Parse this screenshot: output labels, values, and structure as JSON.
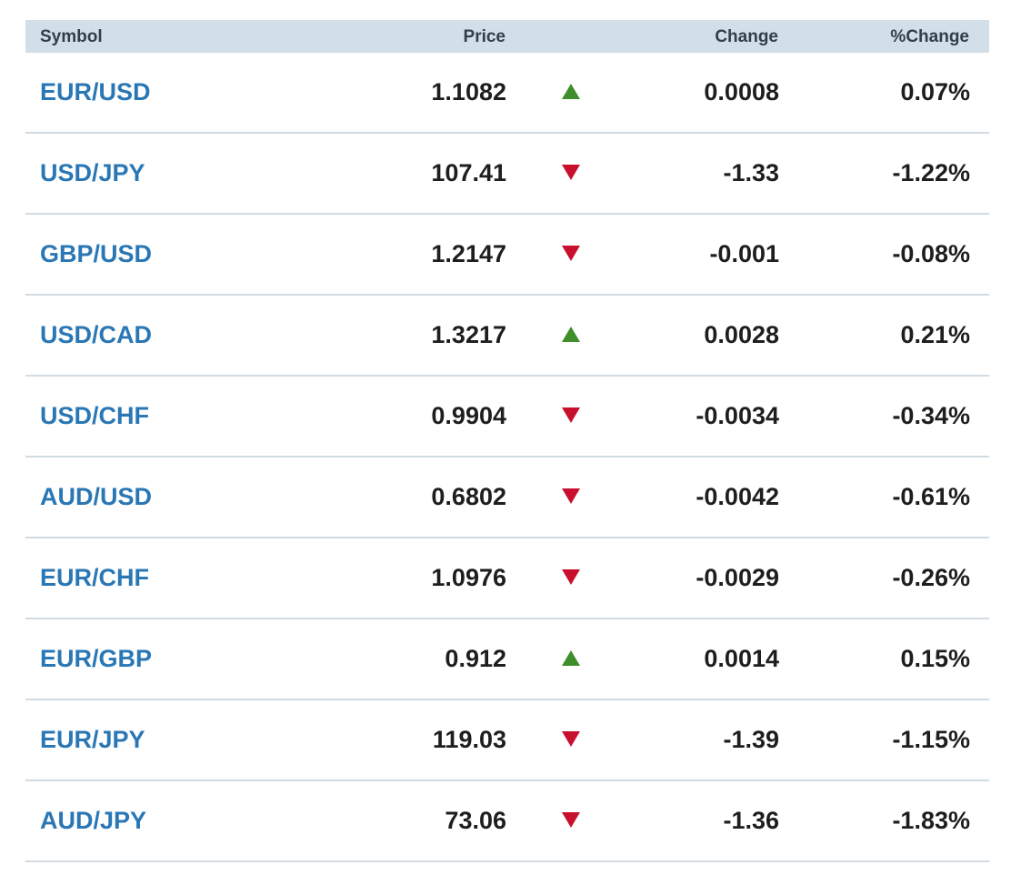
{
  "table": {
    "headers": {
      "symbol": "Symbol",
      "price": "Price",
      "change": "Change",
      "pct_change": "%Change"
    },
    "colors": {
      "up": "#3e8e2b",
      "down": "#c8102e",
      "symbol_link": "#2a77b5",
      "header_bg": "#d2dfe8"
    },
    "rows": [
      {
        "symbol": "EUR/USD",
        "price": "1.1082",
        "direction": "up",
        "change": "0.0008",
        "pct_change": "0.07%"
      },
      {
        "symbol": "USD/JPY",
        "price": "107.41",
        "direction": "down",
        "change": "-1.33",
        "pct_change": "-1.22%"
      },
      {
        "symbol": "GBP/USD",
        "price": "1.2147",
        "direction": "down",
        "change": "-0.001",
        "pct_change": "-0.08%"
      },
      {
        "symbol": "USD/CAD",
        "price": "1.3217",
        "direction": "up",
        "change": "0.0028",
        "pct_change": "0.21%"
      },
      {
        "symbol": "USD/CHF",
        "price": "0.9904",
        "direction": "down",
        "change": "-0.0034",
        "pct_change": "-0.34%"
      },
      {
        "symbol": "AUD/USD",
        "price": "0.6802",
        "direction": "down",
        "change": "-0.0042",
        "pct_change": "-0.61%"
      },
      {
        "symbol": "EUR/CHF",
        "price": "1.0976",
        "direction": "down",
        "change": "-0.0029",
        "pct_change": "-0.26%"
      },
      {
        "symbol": "EUR/GBP",
        "price": "0.912",
        "direction": "up",
        "change": "0.0014",
        "pct_change": "0.15%"
      },
      {
        "symbol": "EUR/JPY",
        "price": "119.03",
        "direction": "down",
        "change": "-1.39",
        "pct_change": "-1.15%"
      },
      {
        "symbol": "AUD/JPY",
        "price": "73.06",
        "direction": "down",
        "change": "-1.36",
        "pct_change": "-1.83%"
      }
    ]
  }
}
